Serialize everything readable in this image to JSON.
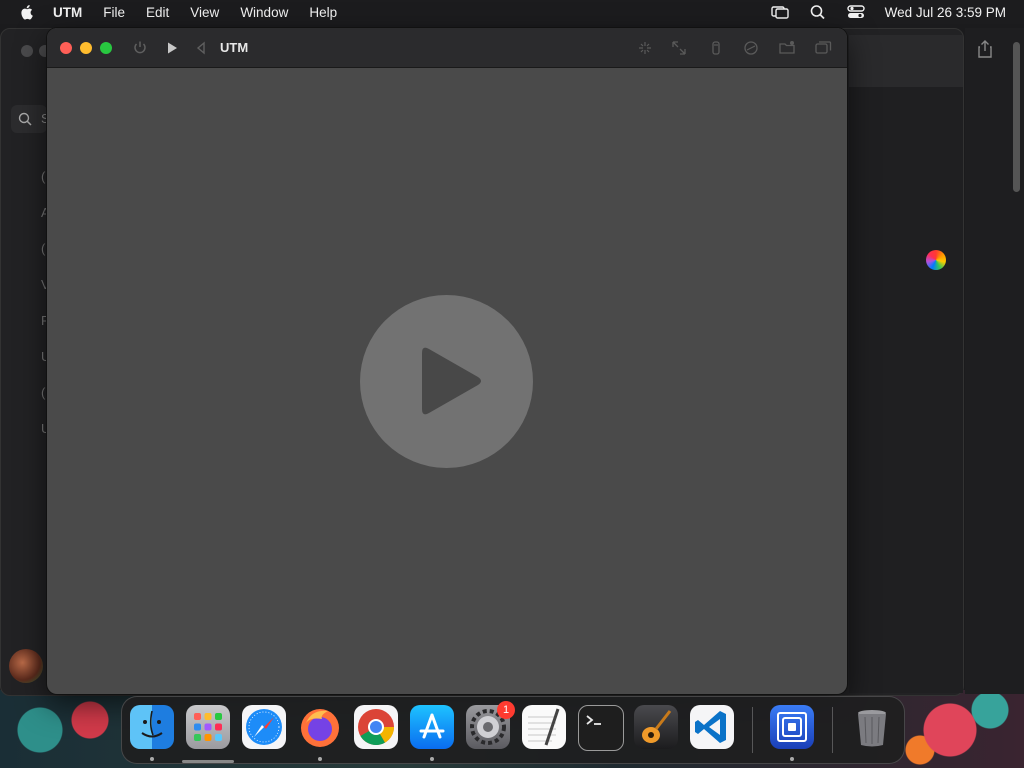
{
  "menubar": {
    "app_name": "UTM",
    "items": [
      "File",
      "Edit",
      "View",
      "Window",
      "Help"
    ],
    "clock": "Wed Jul 26  3:59 PM"
  },
  "background_window": {
    "search_placeholder": "S",
    "sidebar_letters": [
      "(",
      "A",
      "(",
      "V",
      "F",
      "U",
      "(",
      "U"
    ]
  },
  "utm_window": {
    "title": "UTM",
    "toolbar_icons": [
      "power-icon",
      "play-icon",
      "back-icon",
      "sparkle-icon",
      "resize-icon",
      "usb-icon",
      "drive-icon",
      "shared-folder-icon",
      "windows-icon"
    ]
  },
  "dock": {
    "apps": [
      {
        "name": "Finder",
        "running": true
      },
      {
        "name": "Launchpad",
        "running": false
      },
      {
        "name": "Safari",
        "running": false
      },
      {
        "name": "Firefox",
        "running": true
      },
      {
        "name": "Chrome",
        "running": false
      },
      {
        "name": "App Store",
        "running": true
      },
      {
        "name": "System Settings",
        "running": false,
        "badge": "1"
      },
      {
        "name": "TextEdit",
        "running": false
      },
      {
        "name": "Terminal",
        "running": false
      },
      {
        "name": "GarageBand",
        "running": false
      },
      {
        "name": "VS Code",
        "running": false
      },
      {
        "name": "UTM",
        "running": true
      },
      {
        "name": "Trash",
        "running": false
      }
    ]
  },
  "colors": {
    "close": "#fe5f57",
    "minimize": "#febc2e",
    "maximize": "#28c840",
    "vm_background": "#4a4a4a",
    "play_button": "#727272"
  }
}
